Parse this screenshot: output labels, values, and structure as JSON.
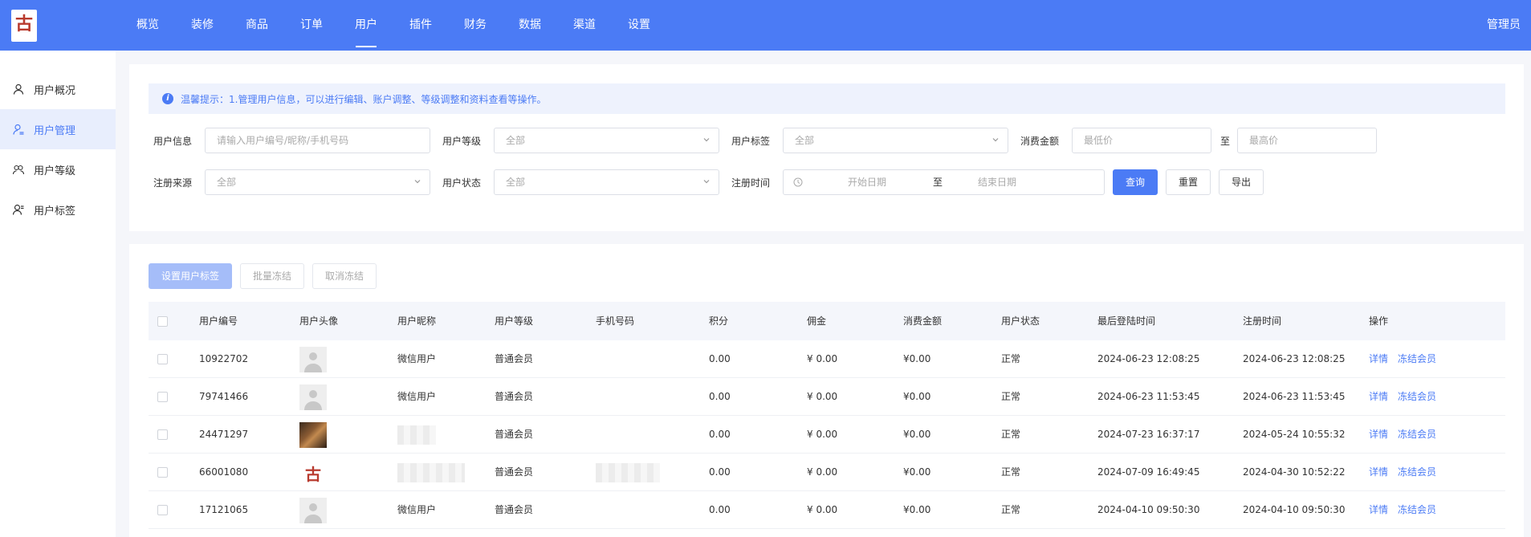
{
  "app": {
    "admin_label": "管理员"
  },
  "nav": [
    "概览",
    "装修",
    "商品",
    "订单",
    "用户",
    "插件",
    "财务",
    "数据",
    "渠道",
    "设置"
  ],
  "nav_active": "用户",
  "sidebar": [
    {
      "label": "用户概况",
      "icon": "user-icon"
    },
    {
      "label": "用户管理",
      "icon": "user-manage-icon",
      "active": true
    },
    {
      "label": "用户等级",
      "icon": "users-group-icon"
    },
    {
      "label": "用户标签",
      "icon": "user-tag-icon"
    }
  ],
  "tip": "温馨提示：1.管理用户信息，可以进行编辑、账户调整、等级调整和资料查看等操作。",
  "filters": {
    "user_info_label": "用户信息",
    "user_info_placeholder": "请输入用户编号/昵称/手机号码",
    "level_label": "用户等级",
    "level_value": "全部",
    "tag_label": "用户标签",
    "tag_value": "全部",
    "amount_label": "消费金额",
    "amount_min_placeholder": "最低价",
    "amount_to": "至",
    "amount_max_placeholder": "最高价",
    "source_label": "注册来源",
    "source_value": "全部",
    "status_label": "用户状态",
    "status_value": "全部",
    "regtime_label": "注册时间",
    "start_date": "开始日期",
    "date_to": "至",
    "end_date": "结束日期",
    "query_button": "查询",
    "reset_button": "重置",
    "export_button": "导出"
  },
  "actions": {
    "set_tag": "设置用户标签",
    "batch_freeze": "批量冻结",
    "cancel_freeze": "取消冻结"
  },
  "table": {
    "columns": [
      "用户编号",
      "用户头像",
      "用户昵称",
      "用户等级",
      "手机号码",
      "积分",
      "佣金",
      "消费金额",
      "用户状态",
      "最后登陆时间",
      "注册时间",
      "操作"
    ],
    "rows": [
      {
        "id": "10922702",
        "avatar": "default",
        "nickname": "微信用户",
        "level": "普通会员",
        "phone": "",
        "points": "0.00",
        "commission": "¥ 0.00",
        "spent": "¥0.00",
        "status": "正常",
        "last_login": "2024-06-23 12:08:25",
        "registered": "2024-06-23 12:08:25",
        "op_detail": "详情",
        "op_freeze": "冻结会员"
      },
      {
        "id": "79741466",
        "avatar": "default",
        "nickname": "微信用户",
        "level": "普通会员",
        "phone": "",
        "points": "0.00",
        "commission": "¥ 0.00",
        "spent": "¥0.00",
        "status": "正常",
        "last_login": "2024-06-23 11:53:45",
        "registered": "2024-06-23 11:53:45",
        "op_detail": "详情",
        "op_freeze": "冻结会员"
      },
      {
        "id": "24471297",
        "avatar": "photo",
        "nickname": "",
        "level": "普通会员",
        "phone": "",
        "points": "0.00",
        "commission": "¥ 0.00",
        "spent": "¥0.00",
        "status": "正常",
        "last_login": "2024-07-23 16:37:17",
        "registered": "2024-05-24 10:55:32",
        "op_detail": "详情",
        "op_freeze": "冻结会员"
      },
      {
        "id": "66001080",
        "avatar": "logo",
        "nickname": "",
        "level": "普通会员",
        "phone": "",
        "points": "0.00",
        "commission": "¥ 0.00",
        "spent": "¥0.00",
        "status": "正常",
        "last_login": "2024-07-09 16:49:45",
        "registered": "2024-04-30 10:52:22",
        "op_detail": "详情",
        "op_freeze": "冻结会员"
      },
      {
        "id": "17121065",
        "avatar": "default",
        "nickname": "微信用户",
        "level": "普通会员",
        "phone": "",
        "points": "0.00",
        "commission": "¥ 0.00",
        "spent": "¥0.00",
        "status": "正常",
        "last_login": "2024-04-10 09:50:30",
        "registered": "2024-04-10 09:50:30",
        "op_detail": "详情",
        "op_freeze": "冻结会员"
      }
    ]
  },
  "colors": {
    "primary": "#4b7bf5",
    "primary_light": "#a5bdf9",
    "tip_bg": "#eef2fd"
  }
}
